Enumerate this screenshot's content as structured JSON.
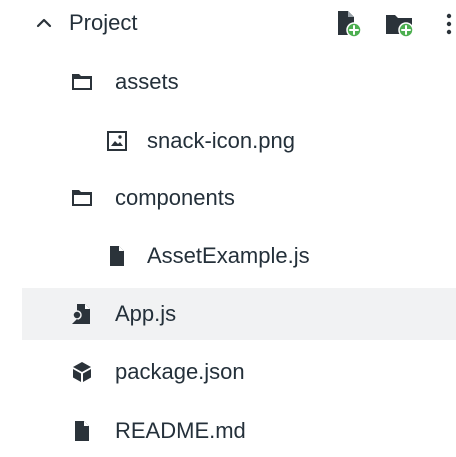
{
  "header": {
    "title": "Project",
    "chevron_icon": "chevron-up-icon",
    "actions": [
      {
        "icon": "new-file-icon"
      },
      {
        "icon": "new-folder-icon"
      },
      {
        "icon": "more-vertical-icon"
      }
    ]
  },
  "tree": {
    "assets": {
      "label": "assets",
      "icon": "folder-icon"
    },
    "snack_icon": {
      "label": "snack-icon.png",
      "icon": "image-file-icon"
    },
    "components": {
      "label": "components",
      "icon": "folder-icon"
    },
    "asset_example": {
      "label": "AssetExample.js",
      "icon": "file-icon"
    },
    "app": {
      "label": "App.js",
      "icon": "app-entry-file-icon",
      "selected": true
    },
    "package": {
      "label": "package.json",
      "icon": "package-icon"
    },
    "readme": {
      "label": "README.md",
      "icon": "file-icon"
    }
  },
  "colors": {
    "text": "#24303a",
    "icon": "#2b333a",
    "accent_green": "#4caf50",
    "selected_row": "#f1f2f3"
  }
}
